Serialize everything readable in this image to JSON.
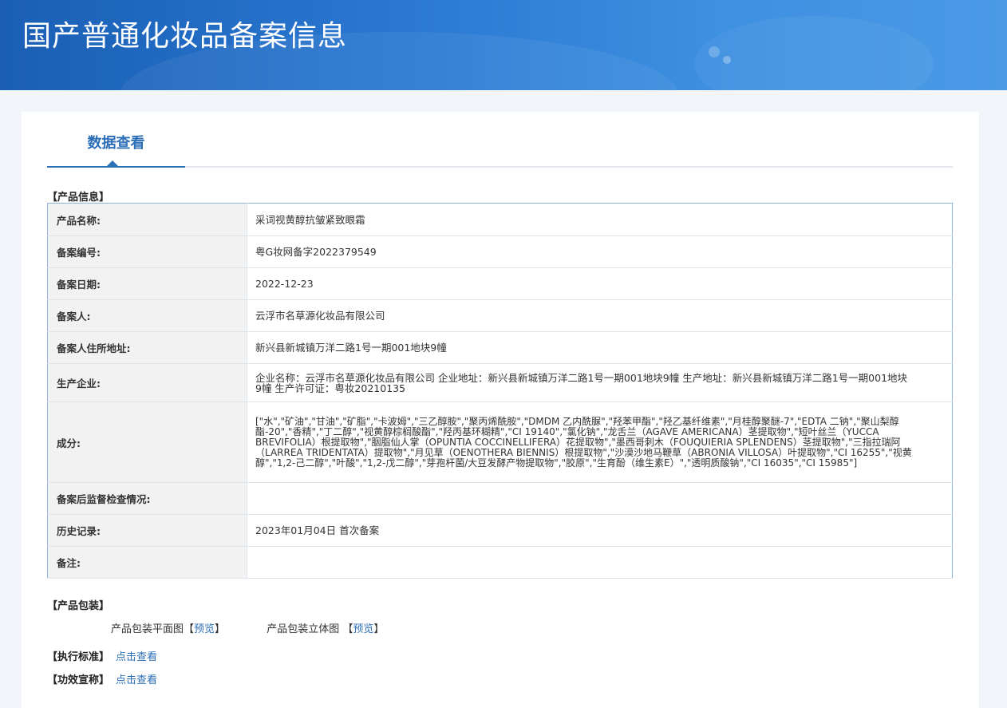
{
  "header": {
    "title": "国产普通化妆品备案信息"
  },
  "tabs": [
    {
      "label": "数据查看"
    }
  ],
  "product_info": {
    "section_title": "【产品信息】",
    "rows": [
      {
        "key": "产品名称:",
        "value": "采词视黄醇抗皱紧致眼霜"
      },
      {
        "key": "备案编号:",
        "value": "粤G妆网备字2022379549"
      },
      {
        "key": "备案日期:",
        "value": "2022-12-23"
      },
      {
        "key": "备案人:",
        "value": "云浮市名草源化妆品有限公司"
      },
      {
        "key": "备案人住所地址:",
        "value": "新兴县新城镇万洋二路1号一期001地块9幢"
      },
      {
        "key": "生产企业:",
        "value": "企业名称：云浮市名草源化妆品有限公司 企业地址：新兴县新城镇万洋二路1号一期001地块9幢 生产地址：新兴县新城镇万洋二路1号一期001地块9幢 生产许可证：粤妆20210135"
      },
      {
        "key": "成分:",
        "value": "[\"水\",\"矿油\",\"甘油\",\"矿脂\",\"卡波姆\",\"三乙醇胺\",\"聚丙烯酰胺\",\"DMDM 乙内酰脲\",\"羟苯甲酯\",\"羟乙基纤维素\",\"月桂醇聚醚-7\",\"EDTA 二钠\",\"聚山梨醇酯-20\",\"香精\",\"丁二醇\",\"视黄醇棕榈酸酯\",\"羟丙基环糊精\",\"CI 19140\",\"氯化钠\",\"龙舌兰（AGAVE AMERICANA）茎提取物\",\"短叶丝兰（YUCCA BREVIFOLIA）根提取物\",\"胭脂仙人掌（OPUNTIA COCCINELLIFERA）花提取物\",\"墨西哥刺木（FOUQUIERIA SPLENDENS）茎提取物\",\"三指拉瑞阿（LARREA TRIDENTATA）提取物\",\"月见草（OENOTHERA BIENNIS）根提取物\",\"沙漠沙地马鞭草（ABRONIA VILLOSA）叶提取物\",\"CI 16255\",\"视黄醇\",\"1,2-己二醇\",\"叶酸\",\"1,2-戊二醇\",\"芽孢杆菌/大豆发酵产物提取物\",\"胶原\",\"生育酚（维生素E）\",\"透明质酸钠\",\"CI 16035\",\"CI 15985\"]"
      },
      {
        "key": "备案后监督检查情况:",
        "value": ""
      },
      {
        "key": "历史记录:",
        "value": "2023年01月04日 首次备案"
      },
      {
        "key": "备注:",
        "value": ""
      }
    ]
  },
  "packaging": {
    "section_title": "【产品包装】",
    "flat_label": "产品包装平面图",
    "solid_label": "产品包装立体图",
    "preview_open": "【",
    "preview_text": "预览",
    "preview_close": "】"
  },
  "standard": {
    "label": "【执行标准】",
    "link": "点击查看"
  },
  "efficacy": {
    "label": "【功效宣称】",
    "link": "点击查看"
  }
}
